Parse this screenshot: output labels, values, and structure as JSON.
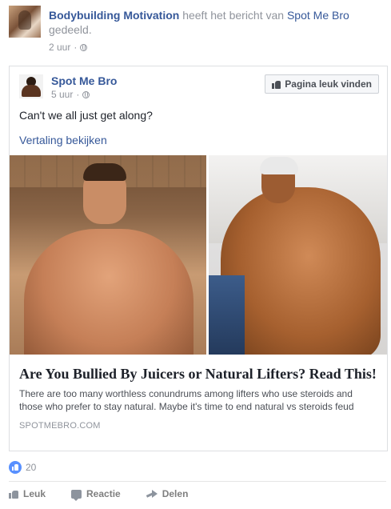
{
  "header": {
    "author": "Bodybuilding Motivation",
    "shared_text": "heeft het bericht van",
    "original_page": "Spot Me Bro",
    "suffix": "gedeeld.",
    "time": "2 uur",
    "dot": "·"
  },
  "shared_post": {
    "page_name": "Spot Me Bro",
    "time": "5 uur",
    "dot": "·",
    "like_page_label": "Pagina leuk vinden",
    "text": "Can't we all just get along?",
    "translate_link": "Vertaling bekijken",
    "link": {
      "title": "Are You Bullied By Juicers or Natural Lifters? Read This!",
      "description": "There are too many worthless conundrums among lifters who use steroids and those who prefer to stay natural. Maybe it's time to end natural vs steroids feud",
      "domain": "SPOTMEBRO.COM"
    }
  },
  "reactions": {
    "count": "20"
  },
  "actions": {
    "like": "Leuk",
    "comment": "Reactie",
    "share": "Delen"
  },
  "colors": {
    "link": "#365899",
    "meta": "#90949c",
    "like_badge": "#5890ff"
  }
}
